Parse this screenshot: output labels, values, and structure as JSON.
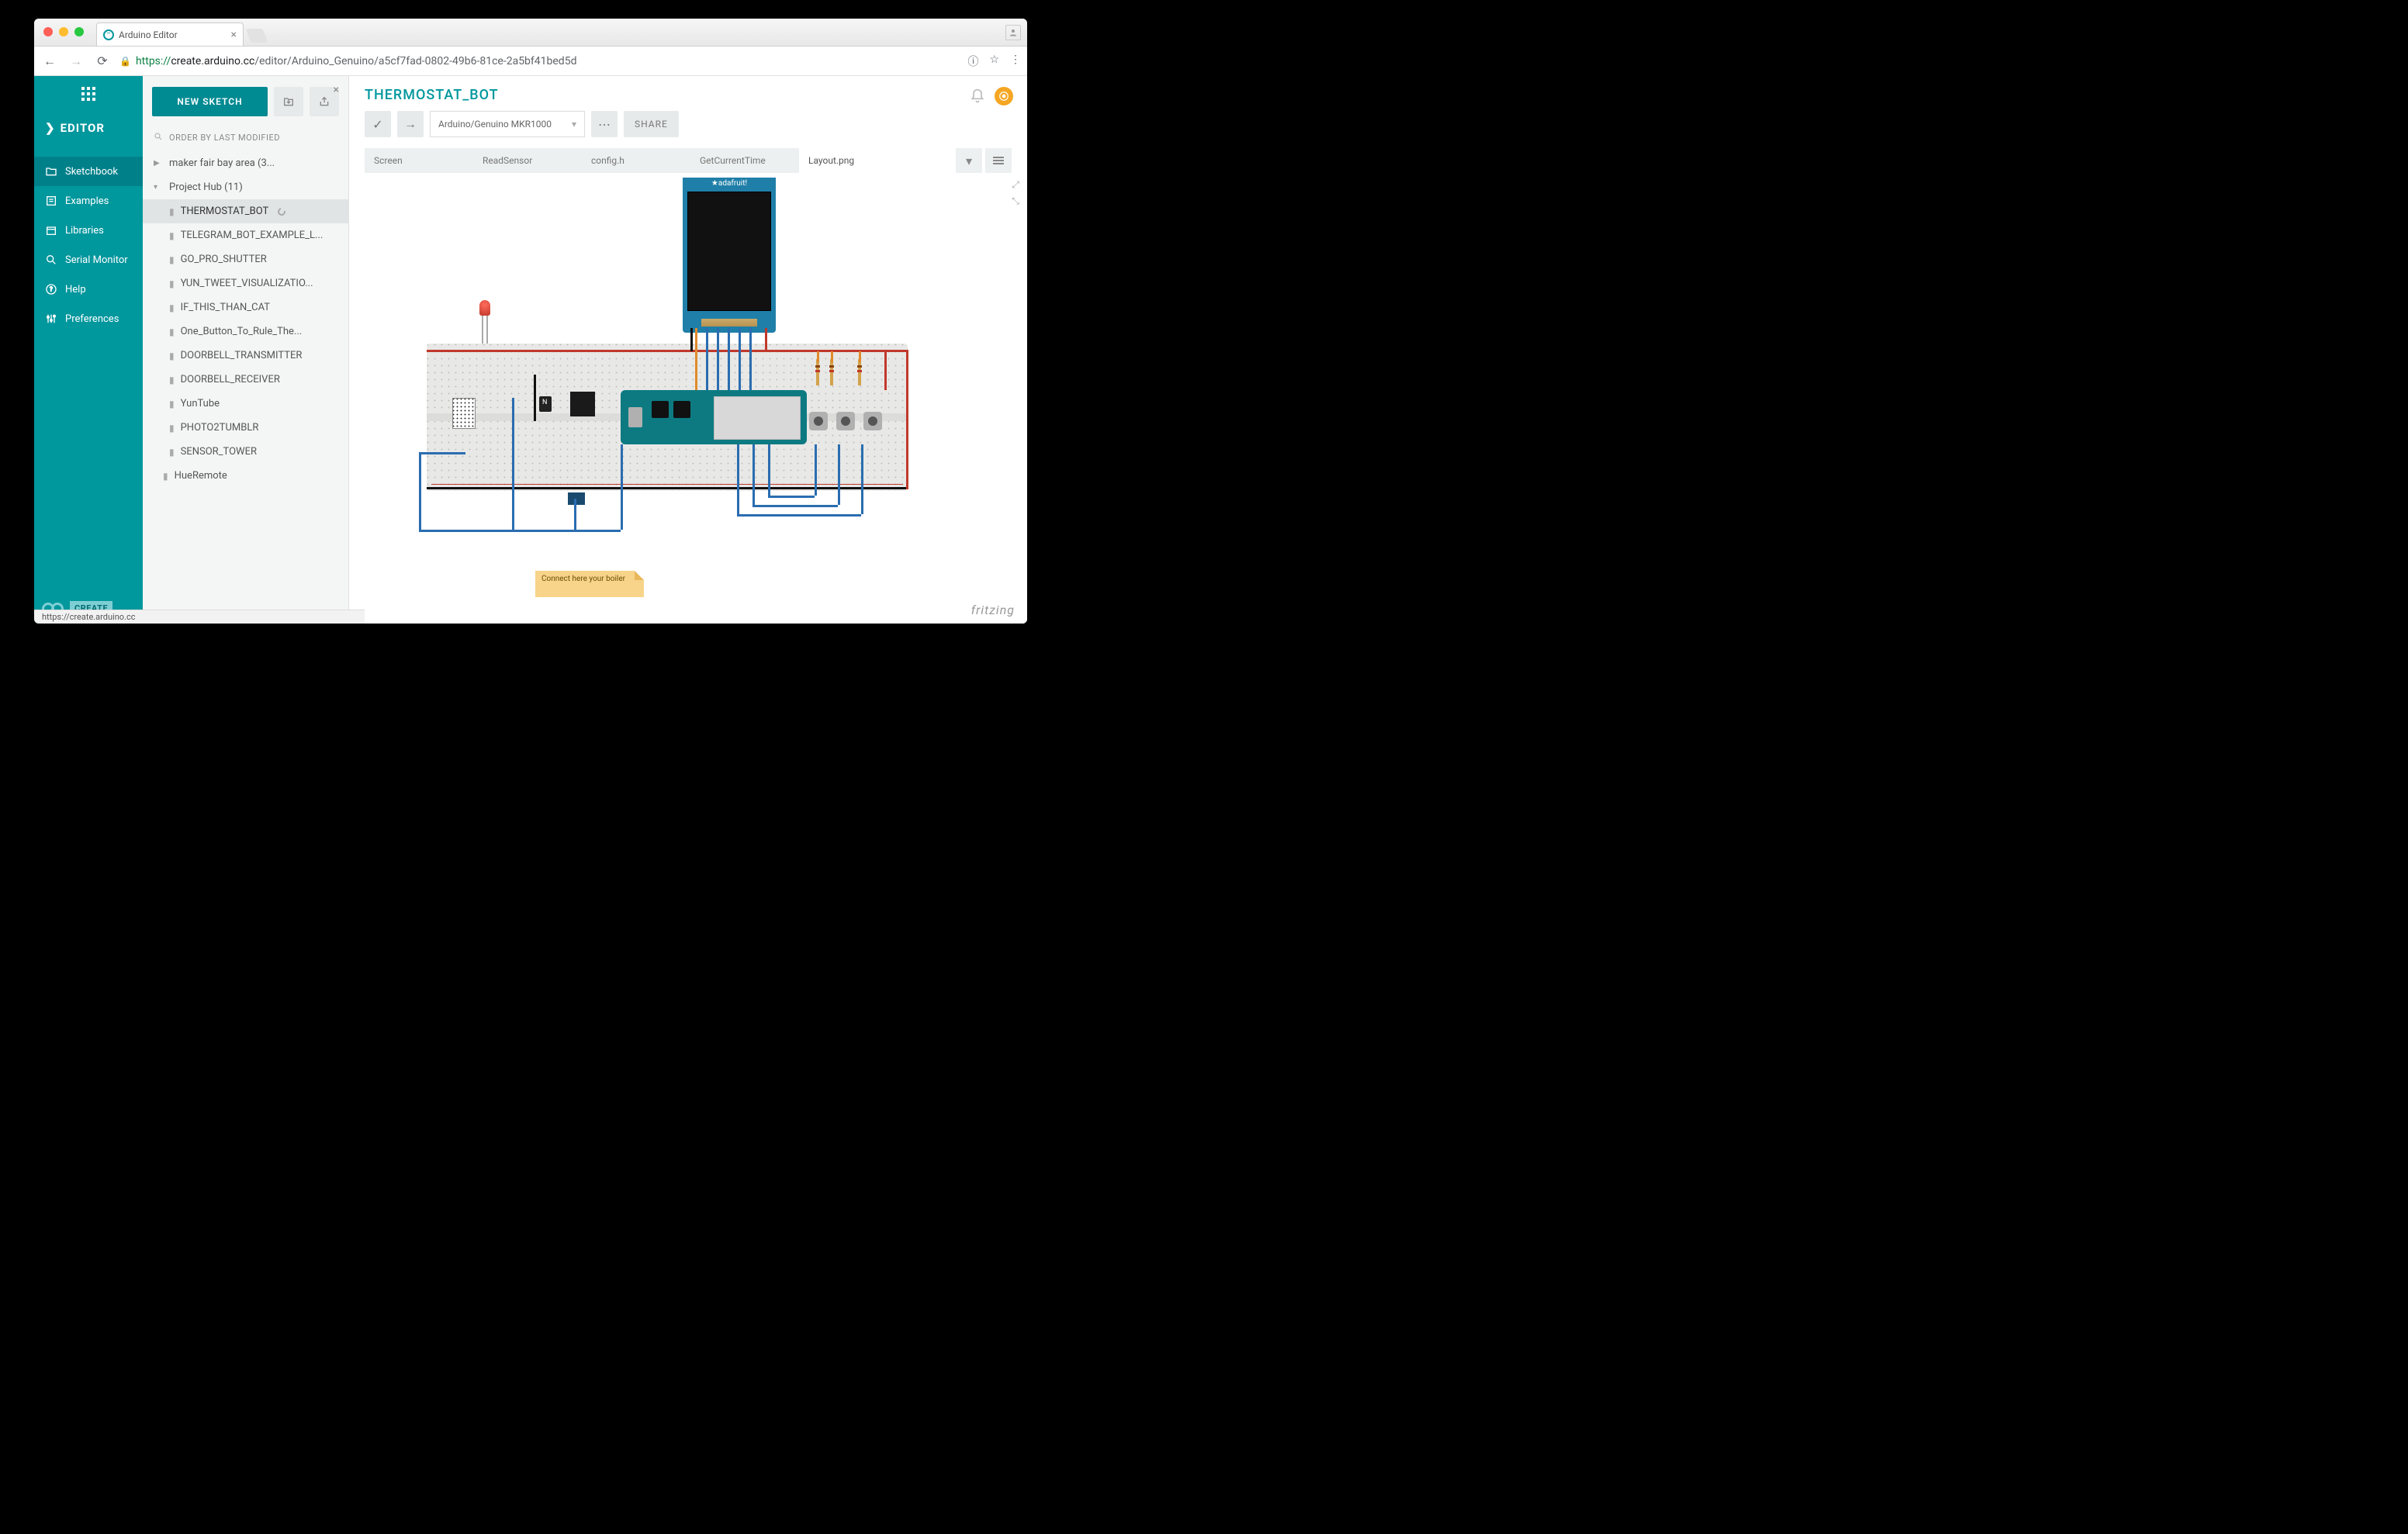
{
  "browser": {
    "tab_title": "Arduino Editor",
    "url_proto": "https://",
    "url_host": "create.arduino.cc",
    "url_path": "/editor/Arduino_Genuino/a5cf7fad-0802-49b6-81ce-2a5bf41bed5d",
    "status_url": "https://create.arduino.cc"
  },
  "leftnav": {
    "editor_label": "EDITOR",
    "items": [
      {
        "label": "Sketchbook",
        "active": true
      },
      {
        "label": "Examples"
      },
      {
        "label": "Libraries"
      },
      {
        "label": "Serial Monitor"
      },
      {
        "label": "Help"
      },
      {
        "label": "Preferences"
      }
    ],
    "create_badge": "CREATE"
  },
  "panel": {
    "new_sketch": "NEW SKETCH",
    "sort_label": "ORDER BY LAST MODIFIED",
    "tree": [
      {
        "label": "maker fair bay area (3...",
        "kind": "folder",
        "expanded": false
      },
      {
        "label": "Project Hub (11)",
        "kind": "folder",
        "expanded": true,
        "children": [
          {
            "label": "THERMOSTAT_BOT",
            "active": true,
            "syncing": true
          },
          {
            "label": "TELEGRAM_BOT_EXAMPLE_L..."
          },
          {
            "label": "GO_PRO_SHUTTER"
          },
          {
            "label": "YUN_TWEET_VISUALIZATIO..."
          },
          {
            "label": "IF_THIS_THAN_CAT"
          },
          {
            "label": "One_Button_To_Rule_The..."
          },
          {
            "label": "DOORBELL_TRANSMITTER"
          },
          {
            "label": "DOORBELL_RECEIVER"
          },
          {
            "label": "YunTube"
          },
          {
            "label": "PHOTO2TUMBLR"
          },
          {
            "label": "SENSOR_TOWER"
          }
        ]
      },
      {
        "label": "HueRemote",
        "kind": "file"
      }
    ]
  },
  "main": {
    "title": "THERMOSTAT_BOT",
    "board": "Arduino/Genuino MKR1000",
    "share": "SHARE",
    "tabs": [
      {
        "label": "Screen"
      },
      {
        "label": "ReadSensor"
      },
      {
        "label": "config.h"
      },
      {
        "label": "GetCurrentTime"
      },
      {
        "label": "Layout.png",
        "active": true
      }
    ]
  },
  "canvas": {
    "tft_brand": "★adafruit!",
    "note_text": "Connect here your boiler",
    "watermark": "fritzing"
  }
}
